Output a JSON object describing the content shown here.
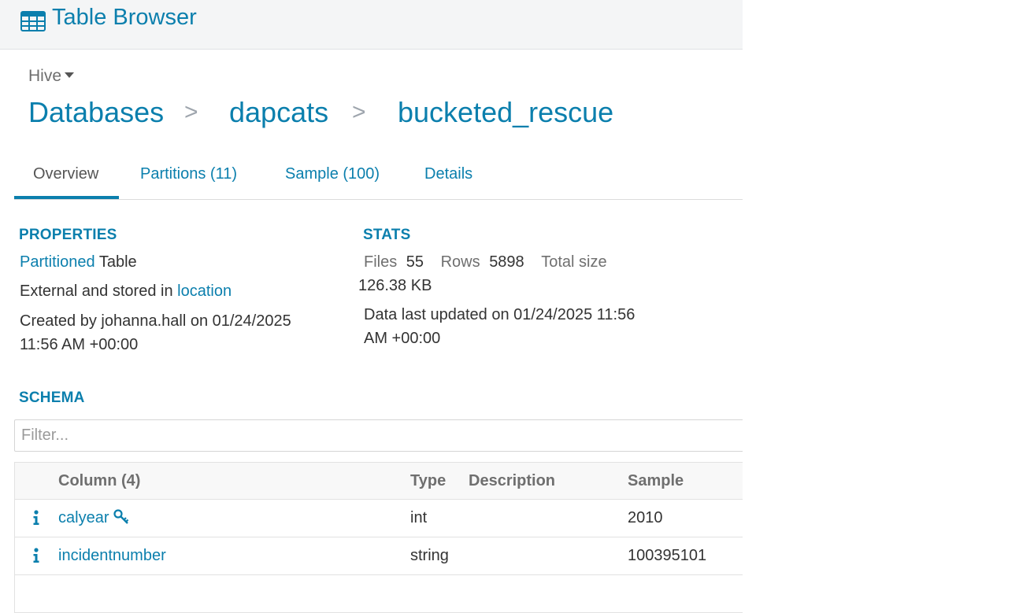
{
  "header": {
    "title": "Table Browser",
    "icon": "table-grid-icon"
  },
  "source": {
    "label": "Hive"
  },
  "breadcrumb": {
    "items": [
      "Databases",
      "dapcats",
      "bucketed_rescue"
    ],
    "separator": ">"
  },
  "tabs": [
    {
      "label": "Overview",
      "active": true
    },
    {
      "label": "Partitions (11)",
      "active": false
    },
    {
      "label": "Sample (100)",
      "active": false
    },
    {
      "label": "Details",
      "active": false
    }
  ],
  "properties": {
    "heading": "PROPERTIES",
    "partitioned_link": "Partitioned",
    "partitioned_suffix": " Table",
    "external_prefix": "External and stored in ",
    "location_link": "location",
    "created_line1": "Created by johanna.hall on 01/24/2025",
    "created_line2": "11:56 AM +00:00"
  },
  "stats": {
    "heading": "STATS",
    "files_label": "Files",
    "files_value": "55",
    "rows_label": "Rows",
    "rows_value": "5898",
    "size_label": "Total size",
    "size_value": "126.38 KB",
    "updated_line1": "Data last updated on 01/24/2025 11:56",
    "updated_line2": "AM +00:00"
  },
  "schema": {
    "heading": "SCHEMA",
    "filter_placeholder": "Filter...",
    "columns": {
      "column": "Column (4)",
      "type": "Type",
      "description": "Description",
      "sample": "Sample"
    },
    "rows": [
      {
        "name": "calyear",
        "type": "int",
        "description": "",
        "sample": "2010",
        "partition_key": true
      },
      {
        "name": "incidentnumber",
        "type": "string",
        "description": "",
        "sample": "100395101",
        "partition_key": false
      }
    ]
  },
  "colors": {
    "accent": "#0b7fad",
    "header_bg": "#f4f5f6",
    "muted": "#6f6f6f"
  }
}
